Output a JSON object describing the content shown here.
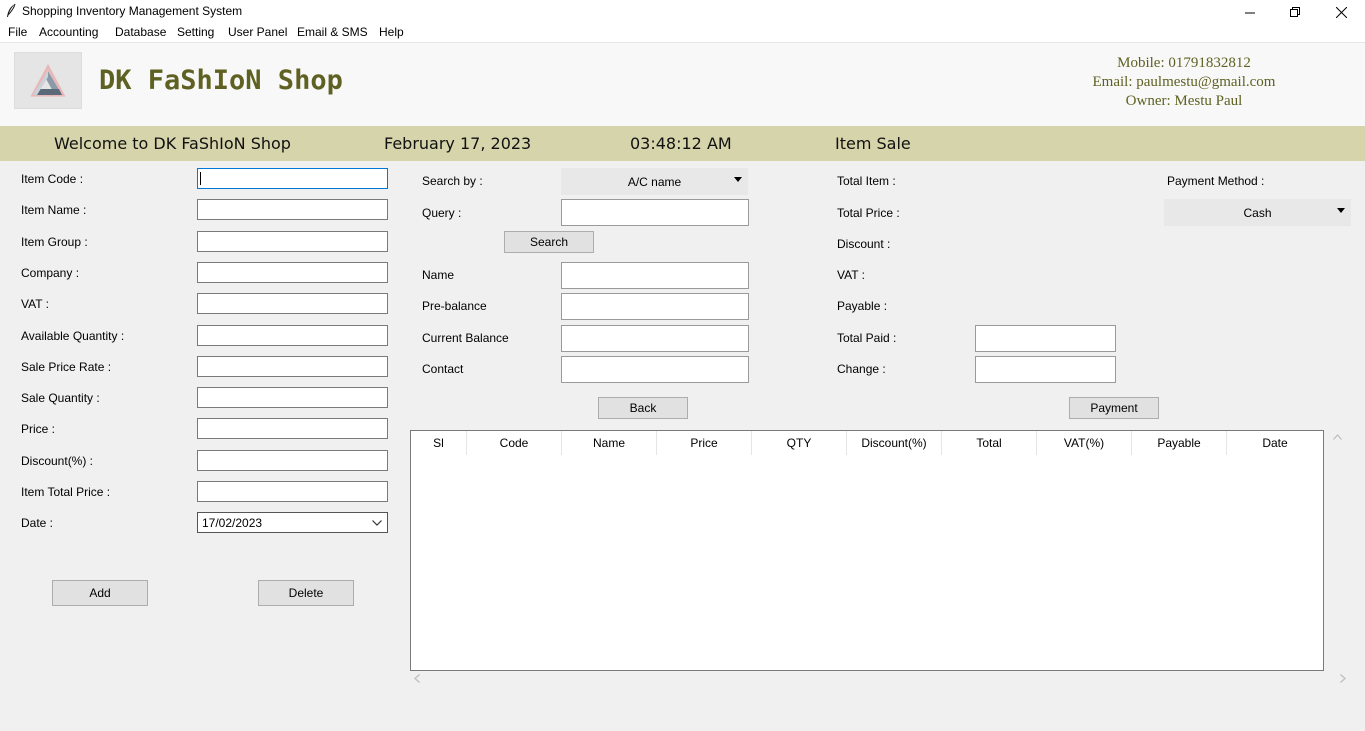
{
  "window": {
    "title": "Shopping Inventory Management System"
  },
  "menu": [
    "File",
    "Accounting",
    "Database",
    "Setting",
    "User Panel",
    "Email & SMS",
    "Help"
  ],
  "header": {
    "shop_name": "DK FaShIoN Shop",
    "mobile": "Mobile: 01791832812",
    "email": "Email: paulmestu@gmail.com",
    "owner": "Owner: Mestu Paul"
  },
  "banner": {
    "welcome": "Welcome to DK FaShIoN Shop",
    "date": "February 17, 2023",
    "time": "03:48:12 AM",
    "section": "Item Sale"
  },
  "item_form": {
    "labels": [
      "Item Code :",
      "Item Name :",
      "Item Group :",
      "Company :",
      "VAT :",
      "Available Quantity :",
      "Sale Price Rate :",
      "Sale Quantity :",
      "Price :",
      "Discount(%) :",
      "Item Total Price :",
      "Date :"
    ],
    "date_value": "17/02/2023",
    "add_label": "Add",
    "delete_label": "Delete"
  },
  "customer": {
    "search_by_label": "Search by :",
    "search_by_value": "A/C name",
    "query_label": "Query :",
    "search_button": "Search",
    "name_label": "Name",
    "prebalance_label": "Pre-balance",
    "current_balance_label": "Current Balance",
    "contact_label": "Contact",
    "back_button": "Back"
  },
  "totals": {
    "total_item_label": "Total Item :",
    "total_price_label": "Total Price :",
    "discount_label": "Discount :",
    "vat_label": "VAT :",
    "payable_label": "Payable :",
    "total_paid_label": "Total Paid :",
    "change_label": "Change :",
    "payment_method_label": "Payment Method :",
    "payment_method_value": "Cash",
    "payment_button": "Payment"
  },
  "table": {
    "columns": [
      "Sl",
      "Code",
      "Name",
      "Price",
      "QTY",
      "Discount(%)",
      "Total",
      "VAT(%)",
      "Payable",
      "Date"
    ]
  },
  "colors": {
    "brand": "#5f6122",
    "banner": "#d6d4aa",
    "focus": "#0078d7"
  }
}
